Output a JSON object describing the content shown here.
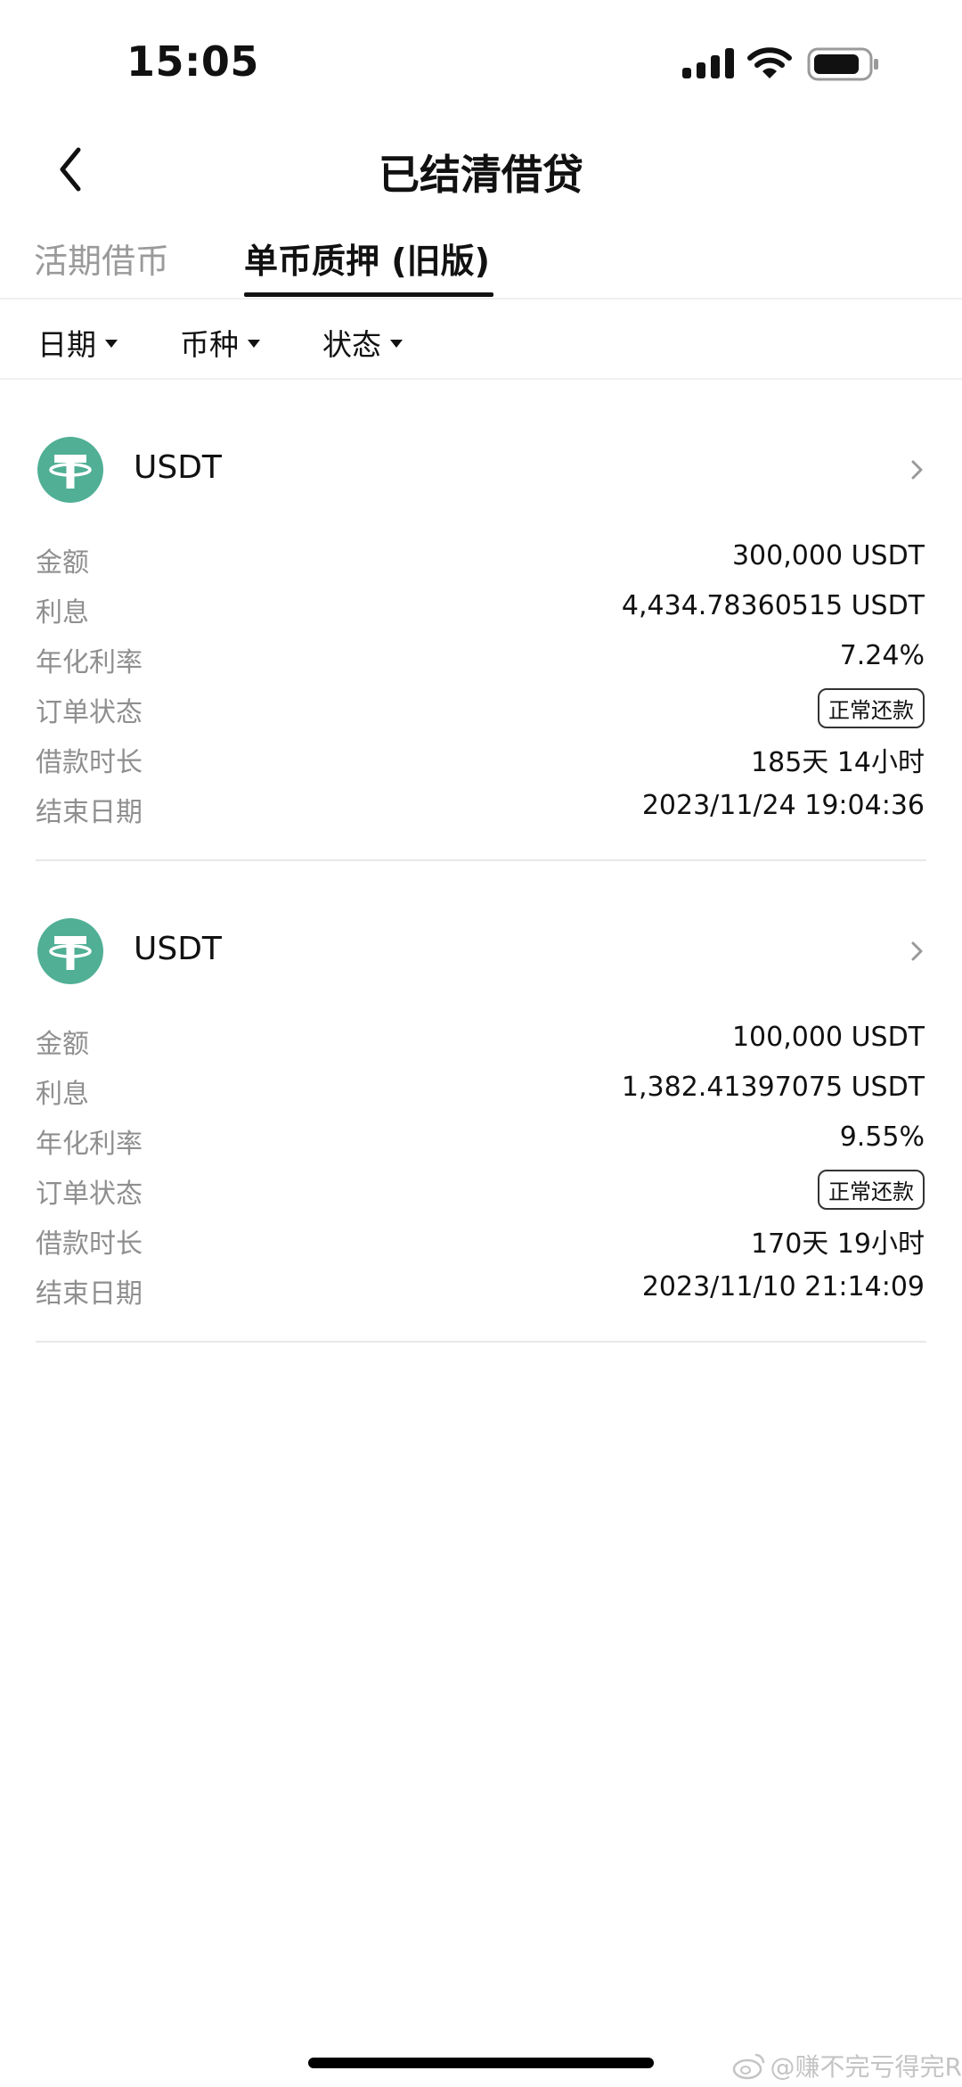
{
  "status_bar": {
    "time": "15:05"
  },
  "header": {
    "title": "已结清借贷"
  },
  "tabs": [
    {
      "label": "活期借币"
    },
    {
      "label": "单币质押 (旧版)"
    }
  ],
  "filters": [
    {
      "label": "日期"
    },
    {
      "label": "币种"
    },
    {
      "label": "状态"
    }
  ],
  "row_labels": {
    "amount": "金额",
    "interest": "利息",
    "apr": "年化利率",
    "status": "订单状态",
    "duration": "借款时长",
    "end_date": "结束日期"
  },
  "loans": [
    {
      "coin": "USDT",
      "amount": "300,000 USDT",
      "interest": "4,434.78360515 USDT",
      "apr": "7.24%",
      "status": "正常还款",
      "duration": "185天 14小时",
      "end_date": "2023/11/24 19:04:36"
    },
    {
      "coin": "USDT",
      "amount": "100,000 USDT",
      "interest": "1,382.41397075 USDT",
      "apr": "9.55%",
      "status": "正常还款",
      "duration": "170天 19小时",
      "end_date": "2023/11/10 21:14:09"
    }
  ],
  "watermark": "@赚不完亏得完R",
  "colors": {
    "tether_green": "#50af95",
    "muted_text": "#8f8f8f"
  }
}
